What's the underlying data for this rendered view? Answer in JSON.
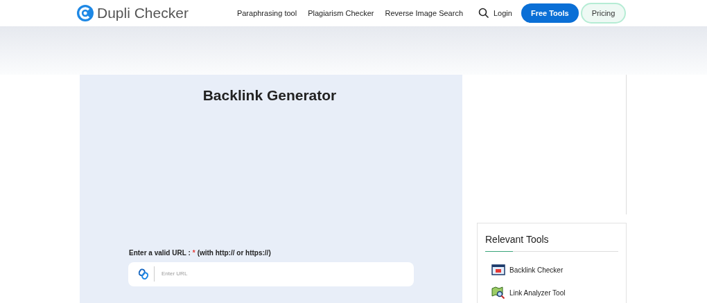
{
  "header": {
    "logo_text": "Dupli Checker",
    "nav": [
      "Paraphrasing tool",
      "Plagiarism Checker",
      "Reverse Image Search"
    ],
    "login": "Login",
    "free_tools": "Free Tools",
    "pricing": "Pricing"
  },
  "tool": {
    "title": "Backlink Generator",
    "label": "Enter a valid URL :",
    "required_mark": "*",
    "hint": "(with http:// or https://)",
    "placeholder": "Enter URL"
  },
  "relevant_tools": {
    "title": "Relevant Tools",
    "items": [
      "Backlink Checker",
      "Link Analyzer Tool"
    ]
  }
}
